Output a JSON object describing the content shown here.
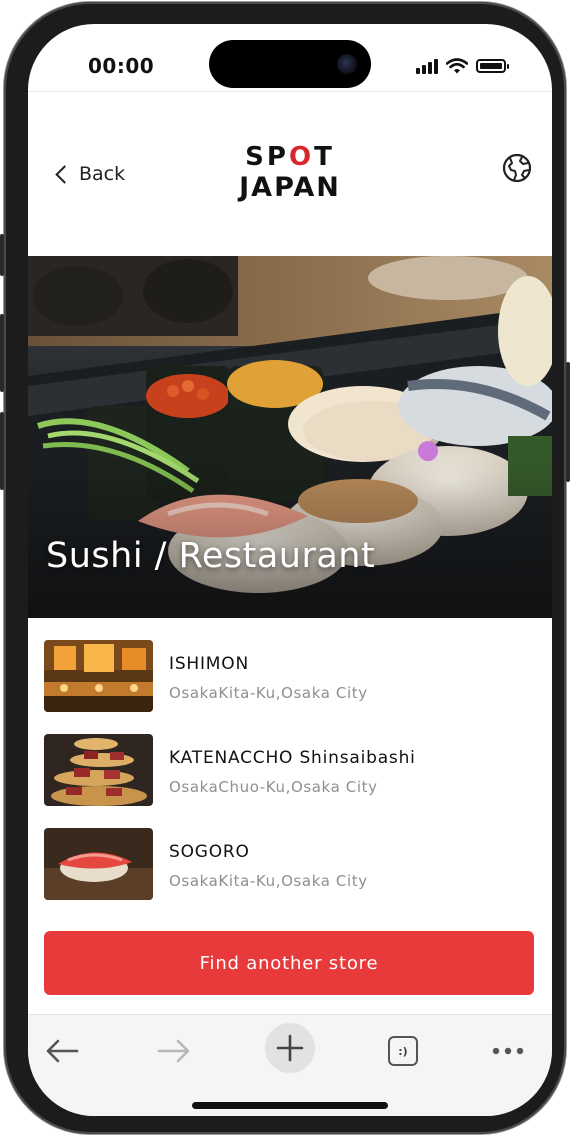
{
  "status_bar": {
    "time": "00:00",
    "icons": [
      "cellular-signal-icon",
      "wifi-icon",
      "battery-icon"
    ]
  },
  "header": {
    "back_label": "Back",
    "logo_line1_left": "SP",
    "logo_line1_accent": "O",
    "logo_line1_right": "T",
    "logo_line2": "JAPAN",
    "language_icon": "globe-icon"
  },
  "hero": {
    "title": "Sushi / Restaurant"
  },
  "stores": [
    {
      "name": "ISHIMON",
      "address": "OsakaKita-Ku,Osaka City"
    },
    {
      "name": "KATENACCHO Shinsaibashi",
      "address": "OsakaChuo-Ku,Osaka City"
    },
    {
      "name": "SOGORO",
      "address": "OsakaKita-Ku,Osaka City"
    }
  ],
  "cta": {
    "label": "Find another store"
  },
  "browser_toolbar": {
    "tab_icon_text": ":)",
    "icons": [
      "back-arrow-icon",
      "forward-arrow-icon",
      "new-tab-plus-icon",
      "tabs-icon",
      "more-icon"
    ]
  },
  "colors": {
    "brand_red": "#e83a3a",
    "logo_red": "#d8262c",
    "text_primary": "#111111",
    "text_secondary": "#8f8f8f"
  }
}
